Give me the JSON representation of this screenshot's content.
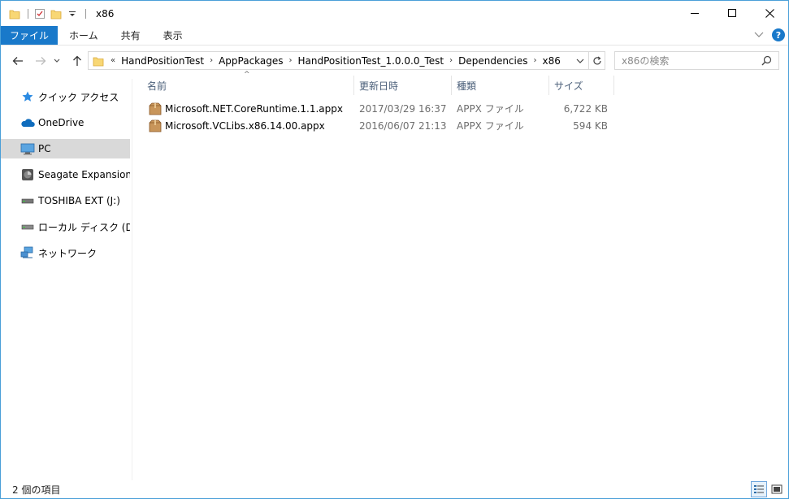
{
  "window": {
    "title": "x86"
  },
  "controls": {
    "minimize": "—",
    "maximize": "☐",
    "close": "✕"
  },
  "ribbon": {
    "tabs": [
      "ファイル",
      "ホーム",
      "共有",
      "表示"
    ]
  },
  "address": {
    "overflow": "«",
    "crumbs": [
      "HandPositionTest",
      "AppPackages",
      "HandPositionTest_1.0.0.0_Test",
      "Dependencies",
      "x86"
    ]
  },
  "search": {
    "placeholder": "x86の検索"
  },
  "sidebar": {
    "items": [
      {
        "label": "クイック アクセス",
        "icon": "star-icon"
      },
      {
        "label": "OneDrive",
        "icon": "cloud-icon"
      },
      {
        "label": "PC",
        "icon": "monitor-icon",
        "selected": true
      },
      {
        "label": "Seagate Expansion Dr",
        "icon": "drive-icon"
      },
      {
        "label": "TOSHIBA EXT (J:)",
        "icon": "usb-drive-icon"
      },
      {
        "label": "ローカル ディスク (D:)",
        "icon": "hard-drive-icon"
      },
      {
        "label": "ネットワーク",
        "icon": "network-icon"
      }
    ]
  },
  "columns": {
    "name": "名前",
    "date": "更新日時",
    "type": "種類",
    "size": "サイズ"
  },
  "files": [
    {
      "name": "Microsoft.NET.CoreRuntime.1.1.appx",
      "date": "2017/03/29 16:37",
      "type": "APPX ファイル",
      "size": "6,722 KB"
    },
    {
      "name": "Microsoft.VCLibs.x86.14.00.appx",
      "date": "2016/06/07 21:13",
      "type": "APPX ファイル",
      "size": "594 KB"
    }
  ],
  "status": {
    "item_count": "2 個の項目"
  },
  "colors": {
    "accent": "#1979ca",
    "border": "#4a9fd8",
    "selected": "#d9d9d9"
  }
}
